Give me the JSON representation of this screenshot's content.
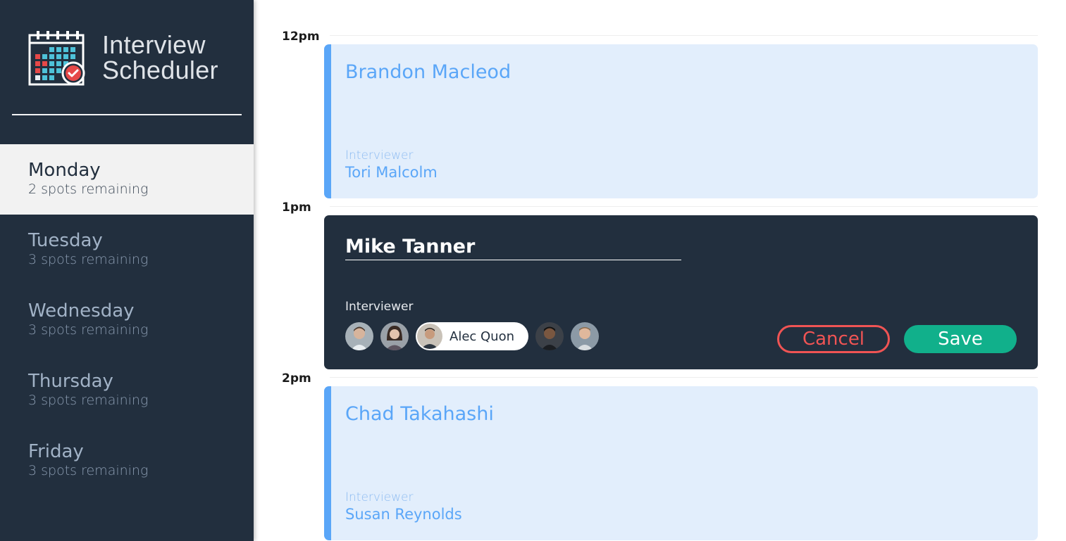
{
  "app": {
    "title_line1": "Interview",
    "title_line2": "Scheduler"
  },
  "colors": {
    "sidebar": "#222f3e",
    "accent_blue": "#5aa6f8",
    "card_bg": "#e2eefc",
    "danger": "#f05454",
    "success": "#11b08b"
  },
  "days": [
    {
      "name": "Monday",
      "spots": "2 spots remaining",
      "selected": true
    },
    {
      "name": "Tuesday",
      "spots": "3 spots remaining"
    },
    {
      "name": "Wednesday",
      "spots": "3 spots remaining"
    },
    {
      "name": "Thursday",
      "spots": "3 spots remaining"
    },
    {
      "name": "Friday",
      "spots": "3 spots remaining"
    }
  ],
  "hours": [
    "12pm",
    "1pm",
    "2pm"
  ],
  "appointments": [
    {
      "student": "Brandon Macleod",
      "interviewer_label": "Interviewer",
      "interviewer": "Tori Malcolm"
    },
    {
      "student": "Chad Takahashi",
      "interviewer_label": "Interviewer",
      "interviewer": "Susan Reynolds"
    }
  ],
  "form": {
    "student_value": "Mike Tanner",
    "interviewer_label": "Interviewer",
    "selected_interviewer": "Alec Quon",
    "cancel_label": "Cancel",
    "save_label": "Save"
  }
}
